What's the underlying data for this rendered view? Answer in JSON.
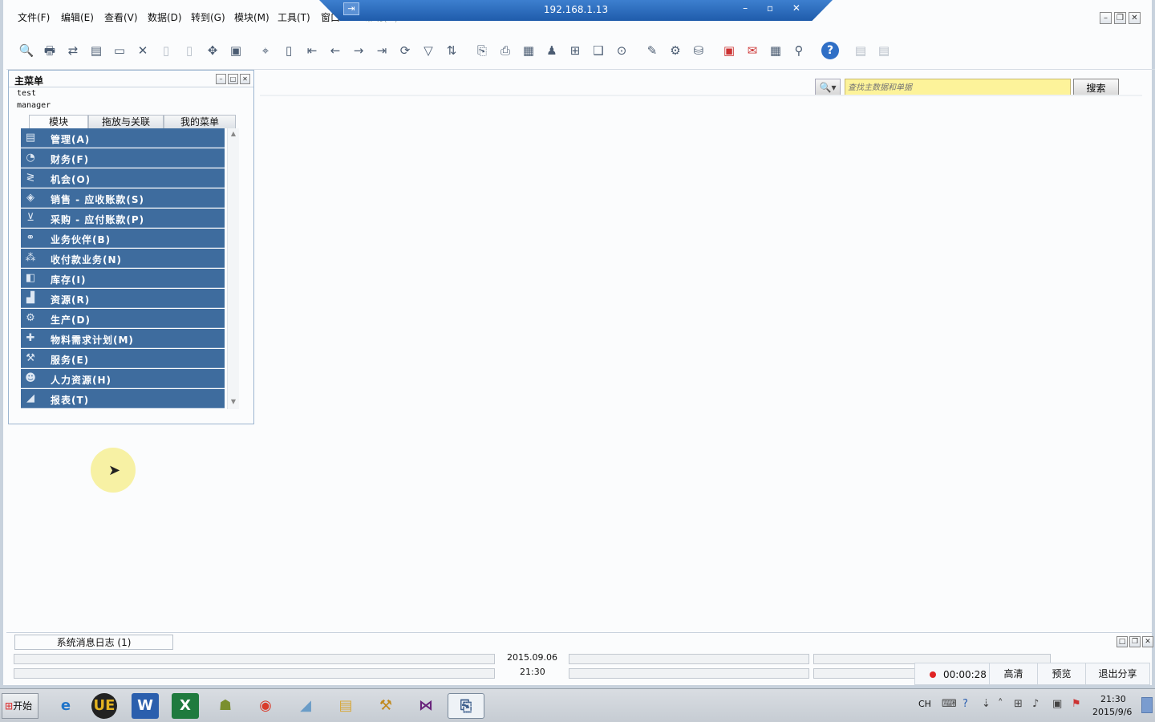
{
  "remote_session": {
    "title": "192.168.1.13",
    "pin": "⇥",
    "controls": "–  ▫  ✕"
  },
  "menubar": [
    "文件(F)",
    "编辑(E)",
    "查看(V)",
    "数据(D)",
    "转到(G)",
    "模块(M)",
    "工具(T)",
    "窗口",
    "帮助(H)"
  ],
  "window_controls": {
    "minimize": "–",
    "restore": "❐",
    "close": "✕"
  },
  "search": {
    "placeholder": "查找主数据和单据",
    "button_label": "搜索",
    "icon": "🔍▾"
  },
  "main_menu": {
    "title": "主菜单",
    "user_line1": "test",
    "user_line2": "manager",
    "tabs": [
      "模块",
      "拖放与关联",
      "我的菜单"
    ],
    "items": [
      {
        "label": "管理(A)",
        "icon": "admin-icon"
      },
      {
        "label": "财务(F)",
        "icon": "finance-icon"
      },
      {
        "label": "机会(O)",
        "icon": "opportunity-icon"
      },
      {
        "label": "销售 - 应收账款(S)",
        "icon": "sales-icon"
      },
      {
        "label": "采购 - 应付账款(P)",
        "icon": "purchase-icon"
      },
      {
        "label": "业务伙伴(B)",
        "icon": "partner-icon"
      },
      {
        "label": "收付款业务(N)",
        "icon": "banking-icon"
      },
      {
        "label": "库存(I)",
        "icon": "inventory-icon"
      },
      {
        "label": "资源(R)",
        "icon": "resources-icon"
      },
      {
        "label": "生产(D)",
        "icon": "production-icon"
      },
      {
        "label": "物料需求计划(M)",
        "icon": "mrp-icon"
      },
      {
        "label": "服务(E)",
        "icon": "service-icon"
      },
      {
        "label": "人力资源(H)",
        "icon": "hr-icon"
      },
      {
        "label": "报表(T)",
        "icon": "reports-icon"
      }
    ]
  },
  "log": {
    "tab_label": "系统消息日志 (1)"
  },
  "status": {
    "date": "2015.09.06",
    "time": "21:30"
  },
  "share": {
    "timer": "00:00:28",
    "hd": "高清",
    "preview": "预览",
    "exit": "退出分享"
  },
  "taskbar": {
    "start_label": "开始",
    "lang": "CH",
    "clock_time": "21:30",
    "clock_date": "2015/9/6"
  },
  "colors": {
    "menu_item_bg": "#3e6c9e",
    "search_bg": "#fdf39a",
    "rdp_bar": "#2a6bbf"
  }
}
